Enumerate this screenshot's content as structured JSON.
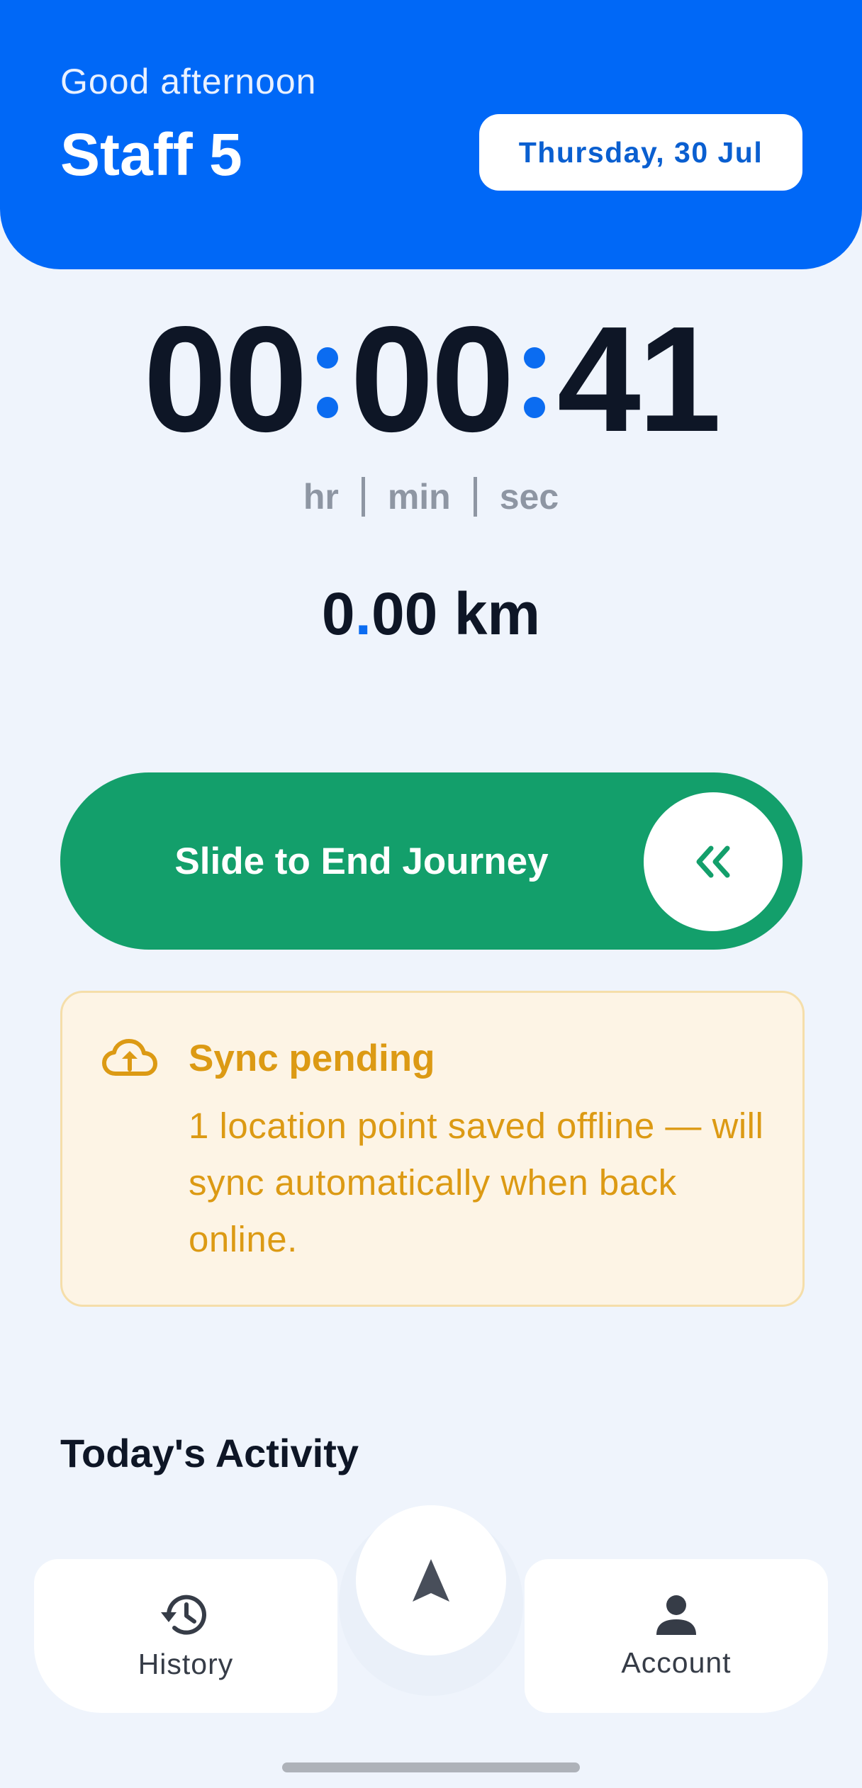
{
  "header": {
    "greeting": "Good afternoon",
    "staff_name": "Staff 5",
    "date": "Thursday, 30 Jul"
  },
  "timer": {
    "hours": "00",
    "minutes": "00",
    "seconds": "41",
    "units": [
      "hr",
      "min",
      "sec"
    ]
  },
  "distance": {
    "whole": "0",
    "decimal_point": ".",
    "fraction": "00",
    "unit": "km"
  },
  "slider": {
    "label": "Slide to End Journey",
    "knob_icon": "chevrons-left-icon"
  },
  "sync_notice": {
    "icon": "cloud-upload-icon",
    "title": "Sync pending",
    "message": "1 location point saved offline — will sync automatically when back online."
  },
  "activity": {
    "title": "Today's Activity"
  },
  "bottom_nav": {
    "left": {
      "label": "History",
      "icon": "history-icon"
    },
    "center": {
      "icon": "navigation-arrow-icon"
    },
    "right": {
      "label": "Account",
      "icon": "person-icon"
    }
  },
  "colors": {
    "primary": "#0068f7",
    "background": "#eff4fc",
    "slider_green": "#139f6b",
    "warning_text": "#dc9a14",
    "warning_bg": "#fdf4e5"
  }
}
